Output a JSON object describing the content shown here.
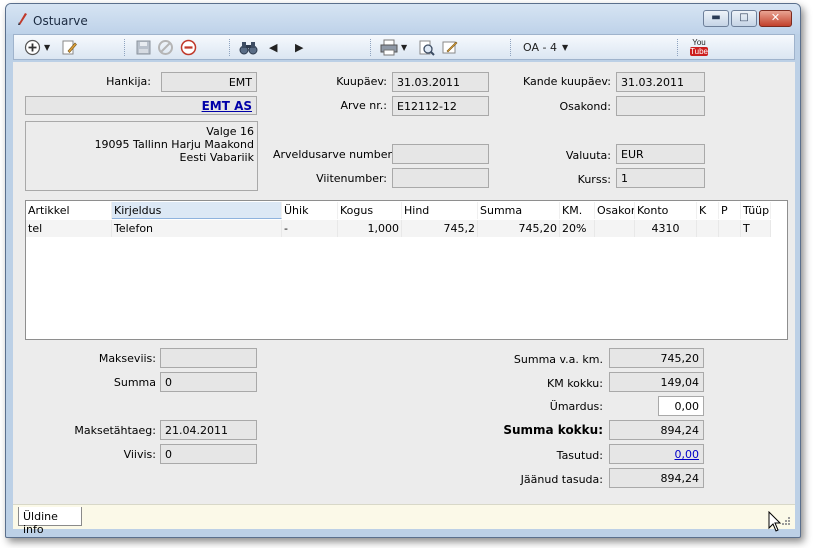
{
  "window": {
    "title": "Ostuarve",
    "min_glyph": "▬",
    "max_glyph": "□",
    "close_glyph": "✕"
  },
  "toolbar": {
    "icons": [
      "add-icon",
      "dropdown-arrow",
      "edit-icon",
      "save-icon",
      "cancel-icon",
      "delete-icon",
      "binoculars-icon",
      "prev-icon",
      "next-icon",
      "print-icon",
      "dropdown-arrow",
      "print-preview-icon",
      "sign-icon",
      "youtube-icon"
    ],
    "series_label": "OA - 4",
    "series_arrow": "▼",
    "add_arrow": "▼",
    "print_arrow": "▼",
    "prev_glyph": "◀",
    "next_glyph": "▶",
    "youtube_top": "You",
    "youtube_bottom": "Tube"
  },
  "header": {
    "supplier_label": "Hankija:",
    "supplier_code": "EMT",
    "supplier_name": "EMT AS",
    "address_lines": [
      "Valge 16",
      "19095 Tallinn Harju Maakond",
      "Eesti Vabariik"
    ],
    "date_label": "Kuupäev:",
    "date_value": "31.03.2011",
    "invoice_no_label": "Arve nr.:",
    "invoice_no_value": "E12112-12",
    "billing_invoice_label": "Arveldusarve number:",
    "billing_invoice_value": "",
    "reference_label": "Viitenumber:",
    "reference_value": "",
    "entry_date_label": "Kande kuupäev:",
    "entry_date_value": "31.03.2011",
    "department_label": "Osakond:",
    "department_value": "",
    "currency_label": "Valuuta:",
    "currency_value": "EUR",
    "rate_label": "Kurss:",
    "rate_value": "1"
  },
  "grid": {
    "columns": [
      "Artikkel",
      "Kirjeldus",
      "Ühik",
      "Kogus",
      "Hind",
      "Summa",
      "KM.",
      "Osakon",
      "Konto",
      "K",
      "P",
      "Tüüp"
    ],
    "rows": [
      [
        "tel",
        "Telefon",
        "-",
        "1,000",
        "745,2",
        "745,20",
        "20%",
        "",
        "4310",
        "",
        "",
        "T"
      ]
    ]
  },
  "payment": {
    "method_label": "Makseviis:",
    "method_value": "",
    "amount_label": "Summa",
    "amount_value": "0",
    "due_label": "Maksetähtaeg:",
    "due_value": "21.04.2011",
    "penalty_label": "Viivis:",
    "penalty_value": "0"
  },
  "totals": {
    "net_label": "Summa v.a. km.",
    "net_value": "745,20",
    "vat_label": "KM kokku:",
    "vat_value": "149,04",
    "rounding_label": "Ümardus:",
    "rounding_value": "0,00",
    "total_label": "Summa kokku:",
    "total_value": "894,24",
    "paid_label": "Tasutud:",
    "paid_value": "0,00",
    "remaining_label": "Jäänud tasuda:",
    "remaining_value": "894,24"
  },
  "tabs": {
    "general": "Üldine info"
  }
}
